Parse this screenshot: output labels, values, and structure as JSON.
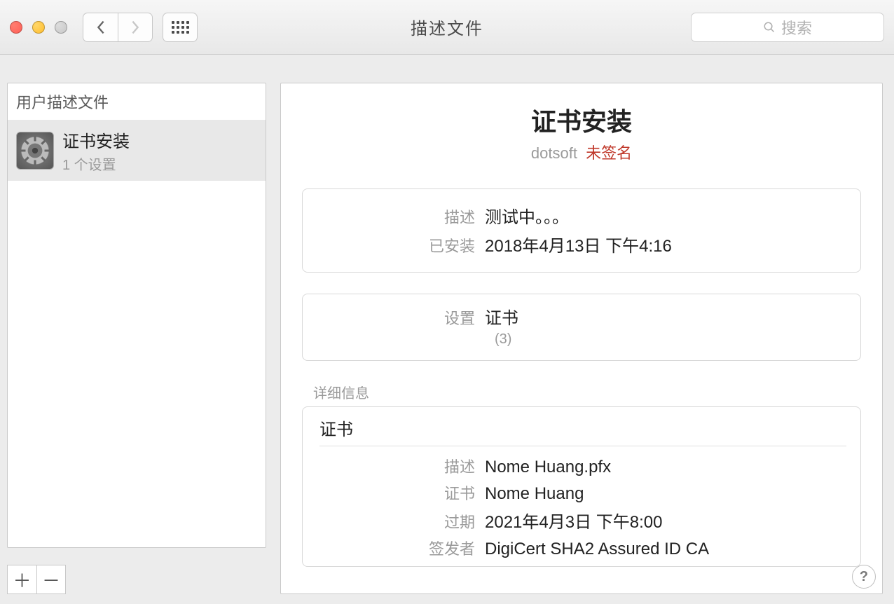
{
  "window": {
    "title": "描述文件",
    "search_placeholder": "搜索"
  },
  "sidebar": {
    "header": "用户描述文件",
    "item": {
      "name": "证书安装",
      "subtitle": "1 个设置"
    }
  },
  "main": {
    "title": "证书安装",
    "org": "dotsoft",
    "signing_status": "未签名",
    "info": {
      "label_desc": "描述",
      "value_desc": "测试中。。。",
      "label_installed": "已安装",
      "value_installed": "2018年4月13日 下午4:16"
    },
    "settings": {
      "label": "设置",
      "value": "证书",
      "count": "(3)"
    },
    "details_section_label": "详细信息",
    "details_header": "证书",
    "cert": {
      "label_desc": "描述",
      "value_desc": "Nome Huang.pfx",
      "label_cert": "证书",
      "value_cert": "Nome Huang",
      "label_exp": "过期",
      "value_exp": "2021年4月3日 下午8:00",
      "label_issuer": "签发者",
      "value_issuer": "DigiCert SHA2 Assured ID CA"
    }
  },
  "buttons": {
    "plus": "＋",
    "minus": "－",
    "help": "?"
  }
}
